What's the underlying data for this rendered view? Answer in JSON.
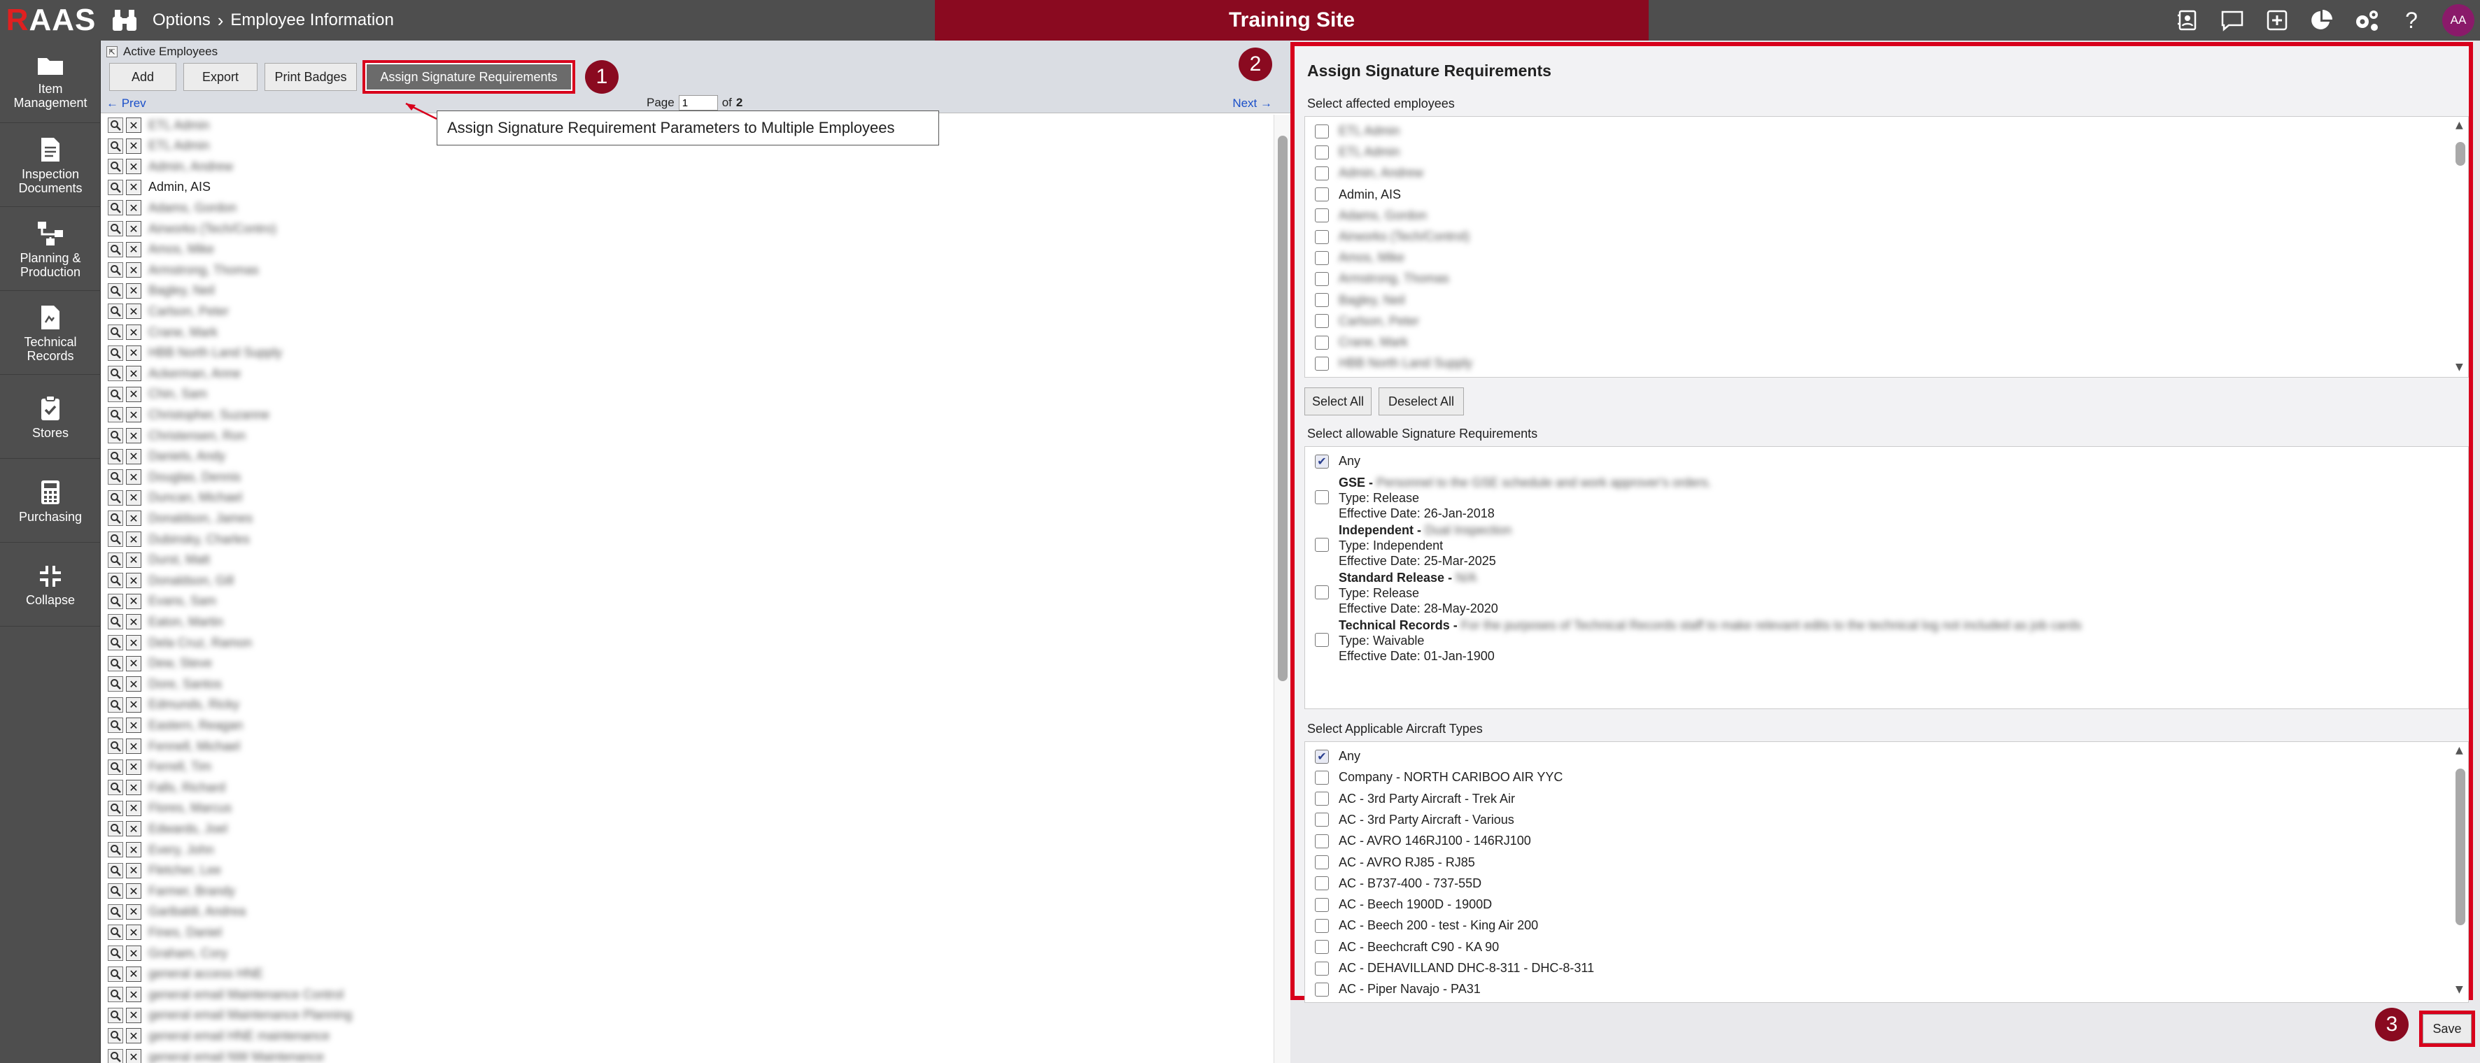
{
  "app": {
    "logo_letter": "R",
    "logo_rest": "AAS",
    "breadcrumb": [
      "Options",
      "Employee Information"
    ],
    "site_label": "Training Site",
    "user_initials": "AA"
  },
  "sidenav": [
    {
      "label": "Item Management",
      "icon": "folder-icon"
    },
    {
      "label": "Inspection Documents",
      "icon": "document-icon"
    },
    {
      "label": "Planning & Production",
      "icon": "workflow-icon"
    },
    {
      "label": "Technical Records",
      "icon": "records-icon"
    },
    {
      "label": "Stores",
      "icon": "clipboard-check-icon"
    },
    {
      "label": "Purchasing",
      "icon": "calculator-icon"
    },
    {
      "label": "Collapse",
      "icon": "collapse-icon"
    }
  ],
  "left": {
    "title": "Active Employees",
    "buttons": {
      "add": "Add",
      "export": "Export",
      "print_badges": "Print Badges",
      "assign": "Assign Signature Requirements"
    },
    "pager": {
      "prev": "← Prev",
      "page_label": "Page",
      "page_value": "1",
      "of_label": "of",
      "total": "2",
      "next": "Next →"
    },
    "tooltip": "Assign Signature Requirement Parameters to Multiple Employees",
    "employees": [
      "ETL Admin",
      "ETL Admin",
      "Admin, Andrew",
      "Admin, AIS",
      "Adams, Gordon",
      "Airworks (Tech/Contro)",
      "Amos, Mike",
      "Armstrong, Thomas",
      "Bagley, Neil",
      "Carlson, Peter",
      "Crane, Mark",
      "HBB North Land Supply",
      "Ackerman, Anne",
      "Chin, Sam",
      "Christopher, Suzanne",
      "Christensen, Ron",
      "Daniels, Andy",
      "Douglas, Dennis",
      "Duncan, Michael",
      "Donaldson, James",
      "Dubinsky, Charles",
      "Durst, Matt",
      "Donaldson, Gill",
      "Evans, Sam",
      "Eaton, Martin",
      "Dela Cruz, Ramon",
      "Dew, Steve",
      "Dore, Santos",
      "Edmunds, Ricky",
      "Eastern, Reagan",
      "Fennell, Michael",
      "Ferrell, Tim",
      "Falls, Richard",
      "Flores, Marcus",
      "Edwards, Joel",
      "Every, John",
      "Fletcher, Lee",
      "Farmer, Brandy",
      "Garibaldi, Andrea",
      "Fines, Daniel",
      "Graham, Cory",
      "general access HNE",
      "general email Maintenance Control",
      "general email Maintenance Planning",
      "general email HNE maintenance",
      "general email NW Maintenance"
    ]
  },
  "right": {
    "title": "Assign Signature Requirements",
    "employees_label": "Select affected employees",
    "employees": [
      "ETL Admin",
      "ETL Admin",
      "Admin, Andrew",
      "Admin, AIS",
      "Adams, Gordon",
      "Airworks (Tech/Control)",
      "Amos, Mike",
      "Armstrong, Thomas",
      "Bagley, Neil",
      "Carlson, Peter",
      "Crane, Mark",
      "HBB North Land Supply"
    ],
    "select_all": "Select All",
    "deselect_all": "Deselect All",
    "sig_label": "Select allowable Signature Requirements",
    "sig_any": "Any",
    "sigs": [
      {
        "name": "GSE",
        "desc": "Personnel to the GSE schedule and work approver's orders.",
        "type": "Type: Release",
        "date": "Effective Date: 26-Jan-2018"
      },
      {
        "name": "Independent",
        "desc": "Dual Inspection",
        "type": "Type: Independent",
        "date": "Effective Date: 25-Mar-2025"
      },
      {
        "name": "Standard Release",
        "desc": "N/A",
        "type": "Type: Release",
        "date": "Effective Date: 28-May-2020"
      },
      {
        "name": "Technical Records",
        "desc": "For the purposes of Technical Records staff to make relevant edits to the technical log not included as job cards",
        "type": "Type: Waivable",
        "date": "Effective Date: 01-Jan-1900"
      }
    ],
    "aircraft_label": "Select Applicable Aircraft Types",
    "aircraft": [
      "Any",
      "Company - NORTH CARIBOO AIR YYC",
      "AC - 3rd Party Aircraft - Trek Air",
      "AC - 3rd Party Aircraft - Various",
      "AC - AVRO 146RJ100 - 146RJ100",
      "AC - AVRO RJ85 - RJ85",
      "AC - B737-400 - 737-55D",
      "AC - Beech 1900D - 1900D",
      "AC - Beech 200 - test - King Air 200",
      "AC - Beechcraft C90 - KA 90",
      "AC - DEHAVILLAND DHC-8-311 - DHC-8-311",
      "AC - Piper Navajo - PA31"
    ],
    "save": "Save"
  },
  "badges": [
    "1",
    "2",
    "3"
  ]
}
